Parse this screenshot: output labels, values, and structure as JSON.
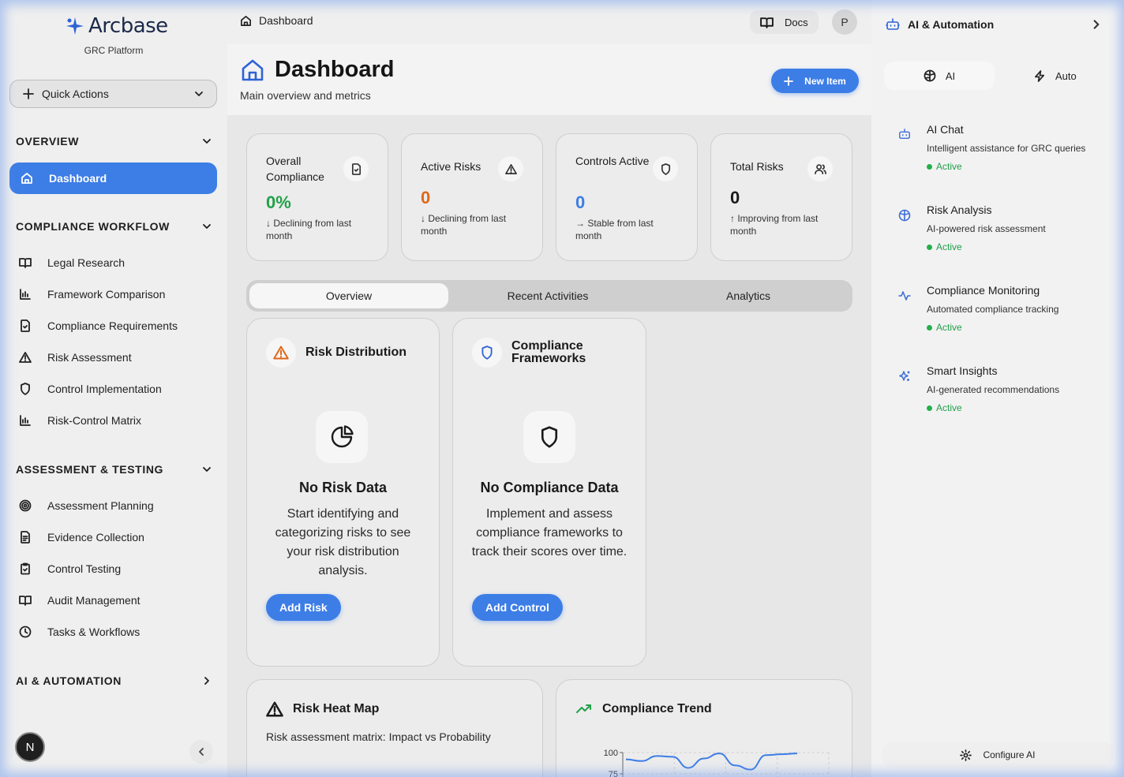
{
  "brand": {
    "name": "Arcbase",
    "subtitle": "GRC Platform"
  },
  "sidebar": {
    "quick_actions": "Quick Actions",
    "sections": [
      {
        "title": "OVERVIEW"
      },
      {
        "title": "COMPLIANCE WORKFLOW"
      },
      {
        "title": "ASSESSMENT & TESTING"
      },
      {
        "title": "AI & AUTOMATION"
      }
    ],
    "active_item": "Dashboard",
    "workflow_items": [
      {
        "label": "Legal Research",
        "icon": "book-icon"
      },
      {
        "label": "Framework Comparison",
        "icon": "bar-chart-icon"
      },
      {
        "label": "Compliance Requirements",
        "icon": "file-check-icon"
      },
      {
        "label": "Risk Assessment",
        "icon": "warning-icon"
      },
      {
        "label": "Control Implementation",
        "icon": "shield-icon"
      },
      {
        "label": "Risk-Control Matrix",
        "icon": "bar-chart-icon"
      }
    ],
    "testing_items": [
      {
        "label": "Assessment Planning",
        "icon": "target-icon"
      },
      {
        "label": "Evidence Collection",
        "icon": "file-text-icon"
      },
      {
        "label": "Control Testing",
        "icon": "clipboard-check-icon"
      },
      {
        "label": "Audit Management",
        "icon": "book-icon"
      },
      {
        "label": "Tasks & Workflows",
        "icon": "clock-icon"
      }
    ],
    "user_initial": "N"
  },
  "header": {
    "breadcrumb": "Dashboard",
    "docs_label": "Docs",
    "user_initial": "P",
    "page_title": "Dashboard",
    "page_subtitle": "Main overview and metrics",
    "new_item_label": "New Item"
  },
  "stats": [
    {
      "label": "Overall Compliance",
      "value": "0%",
      "note": "↓ Declining from last month",
      "color": "#22a04a"
    },
    {
      "label": "Active Risks",
      "value": "0",
      "note": "↓ Declining from last month",
      "color": "#e0661a"
    },
    {
      "label": "Controls Active",
      "value": "0",
      "note": "→ Stable from last month",
      "color": "#3d7de6"
    },
    {
      "label": "Total Risks",
      "value": "0",
      "note": "↑ Improving from last month",
      "color": "#1a1a1a"
    }
  ],
  "tabs": [
    "Overview",
    "Recent Activities",
    "Analytics"
  ],
  "cards": {
    "risk_distribution": {
      "title": "Risk Distribution",
      "empty_title": "No Risk Data",
      "empty_text": "Start identifying and categorizing risks to see your risk distribution analysis.",
      "button": "Add Risk"
    },
    "compliance_frameworks": {
      "title": "Compliance Frameworks",
      "empty_title": "No Compliance Data",
      "empty_text": "Implement and assess compliance frameworks to track their scores over time.",
      "button": "Add Control"
    },
    "heat_map": {
      "title": "Risk Heat Map",
      "subtitle": "Risk assessment matrix: Impact vs Probability"
    },
    "trend": {
      "title": "Compliance Trend"
    }
  },
  "chart_data": {
    "type": "line",
    "title": "Compliance Trend",
    "y_ticks": [
      "100",
      "75"
    ],
    "ylim": [
      75,
      100
    ],
    "values": [
      92,
      90,
      96,
      95,
      82,
      93,
      99,
      85,
      80,
      97,
      98,
      99
    ],
    "grid": true
  },
  "ai_panel": {
    "title": "AI & Automation",
    "tabs": [
      "AI",
      "Auto"
    ],
    "features": [
      {
        "title": "AI Chat",
        "desc": "Intelligent assistance for GRC queries",
        "status": "Active",
        "icon": "bot-icon"
      },
      {
        "title": "Risk Analysis",
        "desc": "AI-powered risk assessment",
        "status": "Active",
        "icon": "brain-icon"
      },
      {
        "title": "Compliance Monitoring",
        "desc": "Automated compliance tracking",
        "status": "Active",
        "icon": "activity-icon"
      },
      {
        "title": "Smart Insights",
        "desc": "AI-generated recommendations",
        "status": "Active",
        "icon": "sparkles-icon"
      }
    ],
    "configure_label": "Configure AI"
  },
  "colors": {
    "accent": "#3d7de6",
    "success": "#22a04a",
    "warning": "#e0661a"
  }
}
